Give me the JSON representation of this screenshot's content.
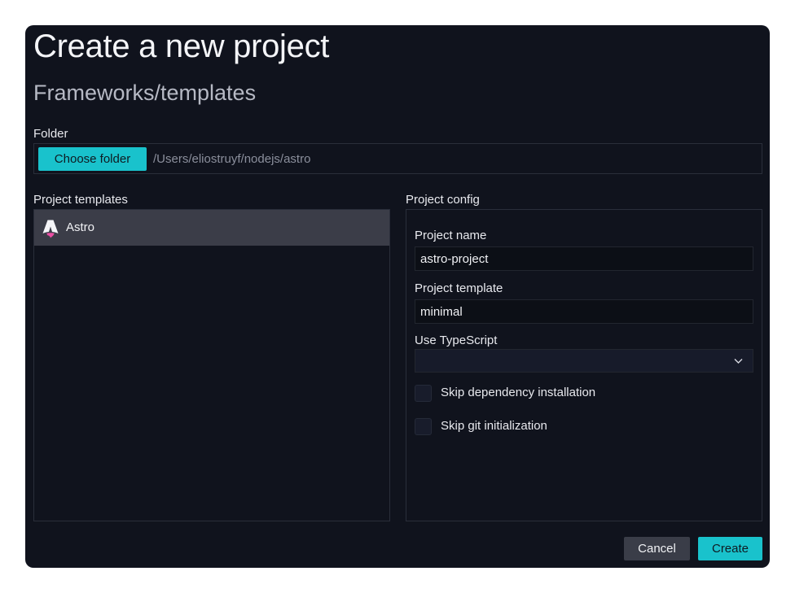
{
  "dialog": {
    "title": "Create a new project",
    "subtitle": "Frameworks/templates"
  },
  "folder": {
    "label": "Folder",
    "choose_button_label": "Choose folder",
    "path": "/Users/eliostruyf/nodejs/astro"
  },
  "templates": {
    "label": "Project templates",
    "items": [
      {
        "name": "Astro",
        "icon": "astro-logo-icon",
        "selected": true
      }
    ]
  },
  "config": {
    "label": "Project config",
    "project_name": {
      "label": "Project name",
      "value": "astro-project"
    },
    "project_template": {
      "label": "Project template",
      "value": "minimal"
    },
    "use_typescript": {
      "label": "Use TypeScript",
      "value": ""
    },
    "skip_dependency_installation": {
      "label": "Skip dependency installation",
      "checked": false
    },
    "skip_git_initialization": {
      "label": "Skip git initialization",
      "checked": false
    }
  },
  "actions": {
    "cancel_label": "Cancel",
    "create_label": "Create"
  },
  "colors": {
    "accent": "#19c2cc",
    "background": "#10131d",
    "selected_item": "#3b3d48",
    "astro_pink": "#e94fa3"
  }
}
